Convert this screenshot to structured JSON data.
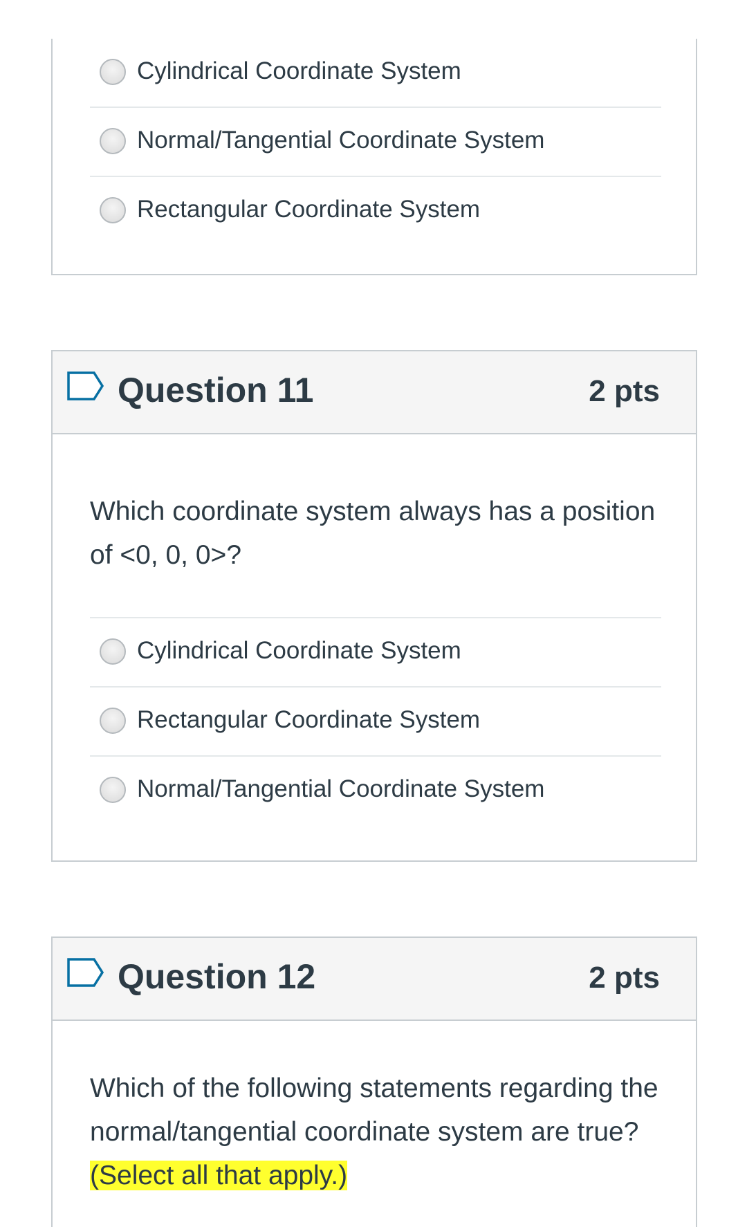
{
  "question10": {
    "answers": [
      {
        "label": "Cylindrical Coordinate System"
      },
      {
        "label": "Normal/Tangential Coordinate System"
      },
      {
        "label": "Rectangular Coordinate System"
      }
    ]
  },
  "question11": {
    "title": "Question 11",
    "points": "2 pts",
    "text": "Which coordinate system always has a position of <0, 0, 0>?",
    "answers": [
      {
        "label": "Cylindrical Coordinate System"
      },
      {
        "label": "Rectangular Coordinate System"
      },
      {
        "label": "Normal/Tangential Coordinate System"
      }
    ]
  },
  "question12": {
    "title": "Question 12",
    "points": "2 pts",
    "text": "Which of the following statements regarding the normal/tangential coordinate system are true?",
    "highlight": "(Select all that apply.)"
  },
  "icons": {
    "flag": "flag-question-icon"
  },
  "colors": {
    "text": "#2d3b45",
    "border": "#c7cdd1",
    "header_bg": "#f5f5f5",
    "highlight": "#ffff2e"
  }
}
